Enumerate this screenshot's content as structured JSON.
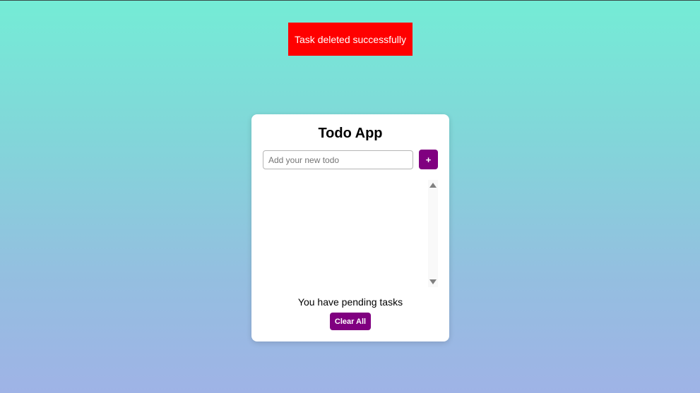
{
  "toast": {
    "message": "Task deleted successfully",
    "color": "#ff0000"
  },
  "app": {
    "title": "Todo App",
    "input": {
      "value": "",
      "placeholder": "Add your new todo"
    },
    "add_button_label": "+",
    "todos": [],
    "pending_text": "You have pending tasks",
    "clear_button_label": "Clear All",
    "accent_color": "#800080"
  }
}
